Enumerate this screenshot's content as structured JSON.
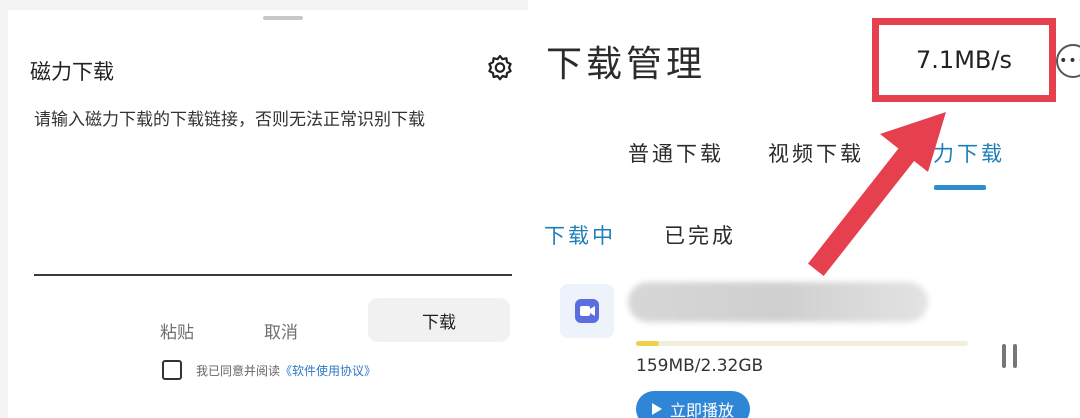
{
  "magnet_panel": {
    "title": "磁力下载",
    "hint": "请输入磁力下载的下载链接，否则无法正常识别下载",
    "paste_label": "粘贴",
    "cancel_label": "取消",
    "download_label": "下载",
    "agree_text": "我已同意并阅读",
    "agreement_link": "《软件使用协议》"
  },
  "manager": {
    "title": "下载管理",
    "speed": "7.1MB/s",
    "more_label": "•••",
    "tabs": [
      {
        "label": "普通下载",
        "active": false
      },
      {
        "label": "视频下载",
        "active": false
      },
      {
        "label": "力下载",
        "active": true
      }
    ],
    "subtabs": [
      {
        "label": "下载中",
        "active": true
      },
      {
        "label": "已完成",
        "active": false
      }
    ],
    "item": {
      "icon": "video-file-icon",
      "progress_fraction": 0.07,
      "size_text": "159MB/2.32GB",
      "play_label": "立即播放"
    }
  },
  "colors": {
    "accent_blue": "#2f86d6",
    "highlight_red": "#e6404f",
    "progress_yellow": "#f0d24a"
  }
}
